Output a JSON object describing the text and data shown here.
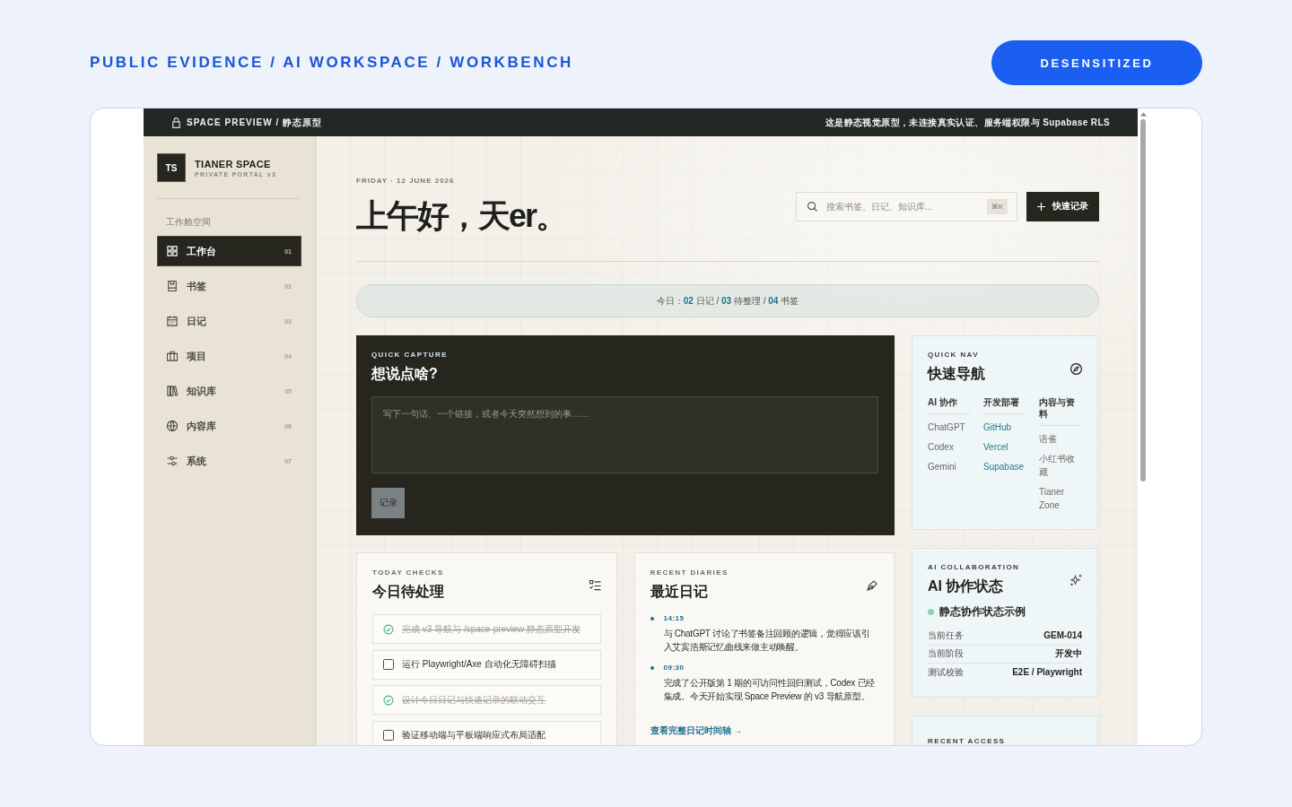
{
  "page": {
    "breadcrumb": "PUBLIC EVIDENCE / AI WORKSPACE / WORKBENCH",
    "badge": "DESENSITIZED"
  },
  "preview_bar": {
    "label": "SPACE PREVIEW / 静态原型",
    "notice": "这是静态视觉原型，未连接真实认证、服务端权限与 Supabase RLS"
  },
  "sidebar": {
    "logo": "TS",
    "title": "TIANER SPACE",
    "subtitle": "PRIVATE PORTAL v3",
    "section": "工作舱空间",
    "items": [
      {
        "label": "工作台",
        "number": "01",
        "selected": true
      },
      {
        "label": "书签",
        "number": "02",
        "selected": false
      },
      {
        "label": "日记",
        "number": "03",
        "selected": false
      },
      {
        "label": "项目",
        "number": "04",
        "selected": false
      },
      {
        "label": "知识库",
        "number": "05",
        "selected": false
      },
      {
        "label": "内容库",
        "number": "06",
        "selected": false
      },
      {
        "label": "系统",
        "number": "07",
        "selected": false
      }
    ]
  },
  "header": {
    "date": "FRIDAY · 12 JUNE 2026",
    "greeting": "上午好，天er。",
    "search": {
      "placeholder": "搜索书签、日记、知识库...",
      "shortcut": "⌘K"
    },
    "quick_button": "快速记录"
  },
  "summary": "今日：**02** 日记 / **03** 待整理 / **04** 书签",
  "quick_capture": {
    "eyebrow": "QUICK CAPTURE",
    "title": "想说点啥?",
    "placeholder": "写下一句话、一个链接，或者今天突然想到的事……",
    "button": "记录"
  },
  "today_checks": {
    "eyebrow": "TODAY CHECKS",
    "title": "今日待处理",
    "items": [
      {
        "text": "完成 v3 导航与 /space-preview 静态原型开发",
        "checked": true
      },
      {
        "text": "运行 Playwright/Axe 自动化无障碍扫描",
        "checked": false
      },
      {
        "text": "设计今日日记与快速记录的联动交互",
        "checked": true
      },
      {
        "text": "验证移动端与平板端响应式布局适配",
        "checked": false
      }
    ]
  },
  "recent_diaries": {
    "eyebrow": "RECENT DIARIES",
    "title": "最近日记",
    "entries": [
      {
        "time": "14:15",
        "text": "与 ChatGPT 讨论了书签备注回顾的逻辑，觉得应该引入艾宾浩斯记忆曲线来做主动唤醒。"
      },
      {
        "time": "09:30",
        "text": "完成了公开版第 1 期的可访问性回归测试，Codex 已经集成。今天开始实现 Space Preview 的 v3 导航原型。"
      }
    ],
    "link": "查看完整日记时间轴 →"
  },
  "quick_nav": {
    "eyebrow": "QUICK NAV",
    "title": "快速导航",
    "columns": [
      {
        "heading": "AI 协作",
        "kind": "plain",
        "links": [
          "ChatGPT",
          "Codex",
          "Gemini"
        ]
      },
      {
        "heading": "开发部署",
        "kind": "accent",
        "links": [
          "GitHub",
          "Vercel",
          "Supabase"
        ]
      },
      {
        "heading": "内容与资料",
        "kind": "plain",
        "links": [
          "语雀",
          "小红书收藏",
          "Tianer Zone"
        ]
      }
    ]
  },
  "ai_collaboration": {
    "eyebrow": "AI COLLABORATION",
    "title": "AI 协作状态",
    "status": "静态协作状态示例",
    "rows": [
      {
        "label": "当前任务",
        "value": "GEM-014"
      },
      {
        "label": "当前阶段",
        "value": "开发中"
      },
      {
        "label": "测试校验",
        "value": "E2E / Playwright"
      }
    ]
  },
  "recent_access": {
    "eyebrow": "RECENT ACCESS"
  }
}
